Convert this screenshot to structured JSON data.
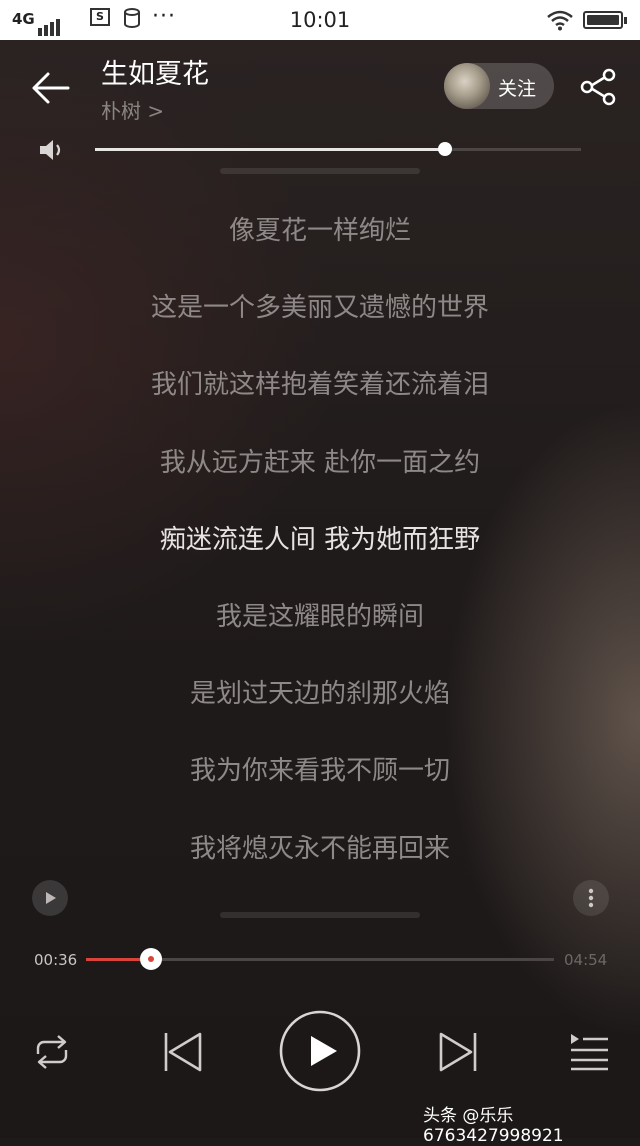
{
  "status_bar": {
    "network": "4G",
    "more": "···",
    "time": "10:01"
  },
  "song": {
    "title": "生如夏花",
    "artist": "朴树 >"
  },
  "follow_label": "关注",
  "volume": {
    "level": 0.72
  },
  "lyrics": [
    {
      "text": "像夏花一样绚烂",
      "current": false
    },
    {
      "text": "这是一个多美丽又遗憾的世界",
      "current": false
    },
    {
      "text": "我们就这样抱着笑着还流着泪",
      "current": false
    },
    {
      "text": "我从远方赶来 赴你一面之约",
      "current": false
    },
    {
      "text": "痴迷流连人间 我为她而狂野",
      "current": true
    },
    {
      "text": "我是这耀眼的瞬间",
      "current": false
    },
    {
      "text": "是划过天边的刹那火焰",
      "current": false
    },
    {
      "text": "我为你来看我不顾一切",
      "current": false
    },
    {
      "text": "我将熄灭永不能再回来",
      "current": false
    }
  ],
  "playback": {
    "current_time": "00:36",
    "total_time": "04:54",
    "progress": 0.138
  },
  "watermark": "头条 @乐乐6763427998921",
  "colors": {
    "accent": "#d9433a",
    "lyric_current": "#e6e3e2",
    "lyric_normal": "#8e8988"
  }
}
